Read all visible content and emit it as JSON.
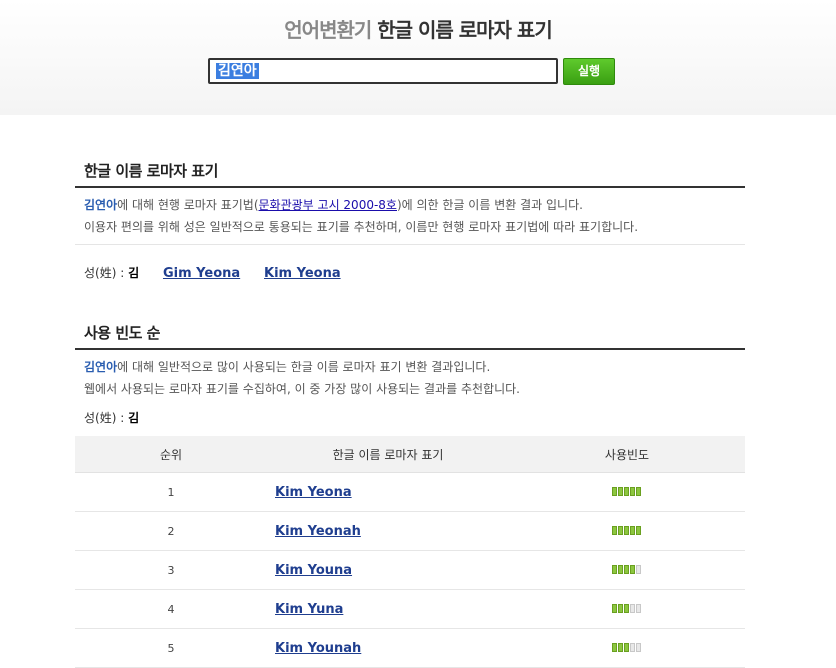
{
  "header": {
    "title_part1": "언어변환기",
    "title_part2": "한글 이름 로마자 표기",
    "search_value": "김연아",
    "run_button": "실행"
  },
  "section1": {
    "title": "한글 이름 로마자 표기",
    "desc1_name": "김연아",
    "desc1_pre": "에 대해 현행 로마자 표기법(",
    "desc1_link": "문화관광부 고시 2000-8호",
    "desc1_post": ")에 의한 한글 이름 변환 결과 입니다.",
    "desc2": "이용자 편의를 위해 성은 일반적으로 통용되는 표기를 추천하며, 이름만 현행 로마자 표기법에 따라 표기합니다.",
    "surname_label": "성(姓) :",
    "surname_value": "김",
    "romanizations": [
      "Gim Yeona",
      "Kim Yeona"
    ]
  },
  "section2": {
    "title": "사용 빈도 순",
    "desc1_name": "김연아",
    "desc1_post": "에 대해 일반적으로 많이 사용되는 한글 이름 로마자 표기 변환 결과입니다.",
    "desc2": "웹에서 사용되는 로마자 표기를 수집하여, 이 중 가장 많이 사용되는 결과를 추천합니다.",
    "surname_label": "성(姓) :",
    "surname_value": "김",
    "table": {
      "headers": [
        "순위",
        "한글 이름 로마자 표기",
        "사용빈도"
      ],
      "rows": [
        {
          "rank": "1",
          "romanization": "Kim Yeona",
          "frequency": 5
        },
        {
          "rank": "2",
          "romanization": "Kim Yeonah",
          "frequency": 5
        },
        {
          "rank": "3",
          "romanization": "Kim Youna",
          "frequency": 4
        },
        {
          "rank": "4",
          "romanization": "Kim Yuna",
          "frequency": 3
        },
        {
          "rank": "5",
          "romanization": "Kim Younah",
          "frequency": 3
        }
      ],
      "frequency_max": 5
    }
  }
}
